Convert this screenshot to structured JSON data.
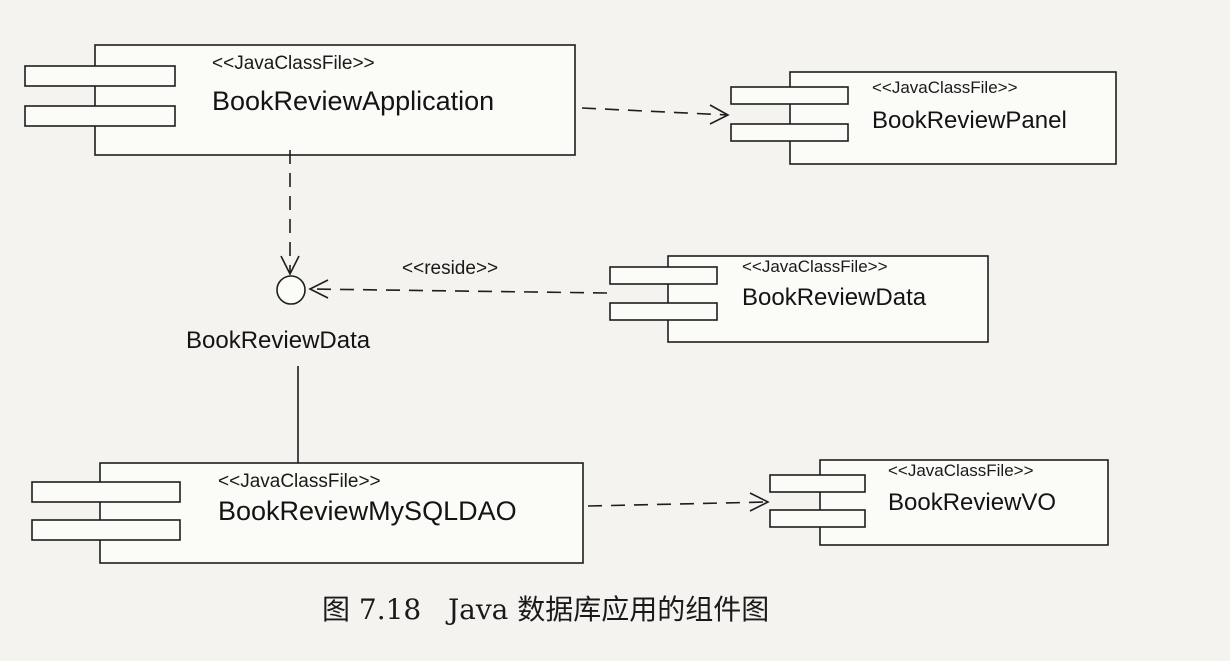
{
  "components": [
    {
      "id": "app",
      "stereotype": "<<JavaClassFile>>",
      "name": "BookReviewApplication"
    },
    {
      "id": "panel",
      "stereotype": "<<JavaClassFile>>",
      "name": "BookReviewPanel"
    },
    {
      "id": "data",
      "stereotype": "<<JavaClassFile>>",
      "name": "BookReviewData"
    },
    {
      "id": "dao",
      "stereotype": "<<JavaClassFile>>",
      "name": "BookReviewMySQLDAO"
    },
    {
      "id": "vo",
      "stereotype": "<<JavaClassFile>>",
      "name": "BookReviewVO"
    }
  ],
  "interface": {
    "name": "BookReviewData"
  },
  "relations": {
    "reside_label": "<<reside>>"
  },
  "caption": "图 7.18   Java 数据库应用的组件图"
}
